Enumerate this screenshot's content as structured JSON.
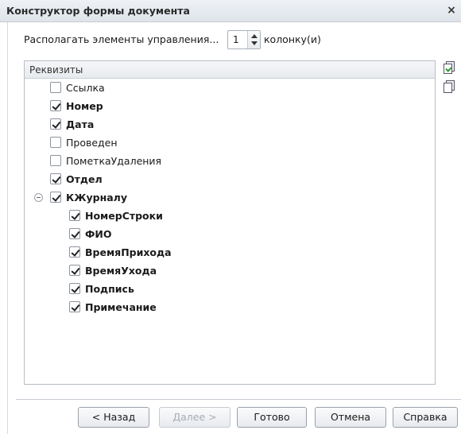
{
  "window": {
    "title": "Конструктор формы документа",
    "close_label": "×"
  },
  "layout_row": {
    "label_before": "Располагать элементы управления...",
    "columns_value": "1",
    "label_after": "колонку(и)"
  },
  "grid": {
    "header": "Реквизиты",
    "items": [
      {
        "label": "Ссылка",
        "checked": false,
        "bold": false,
        "level": 0
      },
      {
        "label": "Номер",
        "checked": true,
        "bold": true,
        "level": 0
      },
      {
        "label": "Дата",
        "checked": true,
        "bold": true,
        "level": 0
      },
      {
        "label": "Проведен",
        "checked": false,
        "bold": false,
        "level": 0
      },
      {
        "label": "ПометкаУдаления",
        "checked": false,
        "bold": false,
        "level": 0
      },
      {
        "label": "Отдел",
        "checked": true,
        "bold": true,
        "level": 0
      },
      {
        "label": "КЖурналу",
        "checked": true,
        "bold": true,
        "level": 0,
        "expanded": true
      },
      {
        "label": "НомерСтроки",
        "checked": true,
        "bold": true,
        "level": 1
      },
      {
        "label": "ФИО",
        "checked": true,
        "bold": true,
        "level": 1
      },
      {
        "label": "ВремяПрихода",
        "checked": true,
        "bold": true,
        "level": 1
      },
      {
        "label": "ВремяУхода",
        "checked": true,
        "bold": true,
        "level": 1
      },
      {
        "label": "Подпись",
        "checked": true,
        "bold": true,
        "level": 1
      },
      {
        "label": "Примечание",
        "checked": true,
        "bold": true,
        "level": 1
      }
    ]
  },
  "side_buttons": [
    {
      "icon": "check-all-icon"
    },
    {
      "icon": "uncheck-all-icon"
    }
  ],
  "buttons": {
    "back": "< Назад",
    "next": "Далее >",
    "finish": "Готово",
    "cancel": "Отмена",
    "help": "Справка"
  }
}
